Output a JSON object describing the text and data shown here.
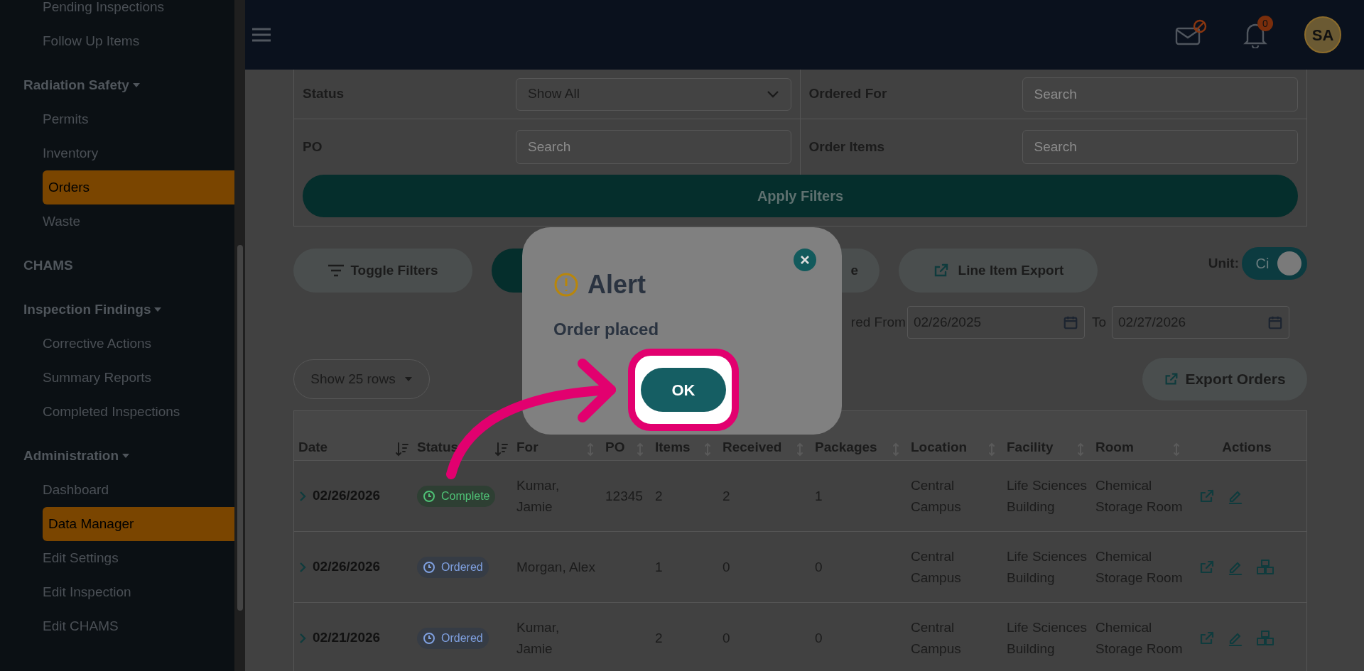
{
  "sidebar": {
    "groups": [
      {
        "items": [
          {
            "label": "Pending Inspections",
            "selected": false
          },
          {
            "label": "Follow Up Items",
            "selected": false
          }
        ]
      },
      {
        "title": "Radiation Safety",
        "expanded": true,
        "items": [
          {
            "label": "Permits",
            "selected": false
          },
          {
            "label": "Inventory",
            "selected": false
          },
          {
            "label": "Orders",
            "selected": true
          },
          {
            "label": "Waste",
            "selected": false
          }
        ]
      },
      {
        "title": "CHAMS"
      },
      {
        "title": "Inspection Findings",
        "expanded": true,
        "items": [
          {
            "label": "Corrective Actions",
            "selected": false
          },
          {
            "label": "Summary Reports",
            "selected": false
          },
          {
            "label": "Completed Inspections",
            "selected": false
          }
        ]
      },
      {
        "title": "Administration",
        "expanded": true,
        "items": [
          {
            "label": "Dashboard",
            "selected": false
          },
          {
            "label": "Data Manager",
            "selected": true
          },
          {
            "label": "Edit Settings",
            "selected": false
          },
          {
            "label": "Edit Inspection",
            "selected": false
          },
          {
            "label": "Edit CHAMS",
            "selected": false
          }
        ]
      }
    ]
  },
  "header": {
    "notifications_badge": "0",
    "avatar": "SA"
  },
  "filters": {
    "rows": [
      {
        "label": "Status",
        "kind": "select",
        "value": "Show All"
      },
      {
        "label": "Ordered For",
        "kind": "search",
        "placeholder": "Search"
      },
      {
        "label": "PO",
        "kind": "search",
        "placeholder": "Search"
      },
      {
        "label": "Order Items",
        "kind": "search",
        "placeholder": "Search"
      }
    ],
    "apply_button": "Apply Filters"
  },
  "toolbar": {
    "toggle_filters": "Toggle Filters",
    "covered_button": "e",
    "line_item_export": "Line Item Export",
    "unit_label": "Unit:",
    "unit_switch": {
      "label": "Ci",
      "on": true
    }
  },
  "date_range": {
    "from_label": "red From",
    "from": "02/26/2025",
    "to_label": "To",
    "to": "02/27/2026"
  },
  "rows_select": "Show 25 rows",
  "export_button": "Export Orders",
  "table": {
    "columns": [
      "Date",
      "Status",
      "For",
      "PO",
      "Items",
      "Received",
      "Packages",
      "Location",
      "Facility",
      "Room",
      "Actions"
    ],
    "rows": [
      {
        "date": "02/26/2026",
        "status": {
          "kind": "complete",
          "label": "Complete"
        },
        "ordered_for": "Kumar, Jamie",
        "po": "12345",
        "items": "2",
        "received": "2",
        "packages": "1",
        "location": "Central Campus",
        "facility": "Life Sciences Building",
        "room": "Chemical Storage Room",
        "package_action": false
      },
      {
        "date": "02/26/2026",
        "status": {
          "kind": "ordered",
          "label": "Ordered"
        },
        "ordered_for": "Morgan, Alex",
        "items": "1",
        "received": "0",
        "packages": "0",
        "location": "Central Campus",
        "facility": "Life Sciences Building",
        "room": "Chemical Storage Room",
        "package_action": true
      },
      {
        "date": "02/21/2026",
        "status": {
          "kind": "ordered",
          "label": "Ordered"
        },
        "ordered_for": "Kumar, Jamie",
        "items": "2",
        "received": "0",
        "packages": "0",
        "location": "Central Campus",
        "facility": "Life Sciences Building",
        "room": "Chemical Storage Room",
        "package_action": true
      }
    ]
  },
  "modal": {
    "title": "Alert",
    "message": "Order placed",
    "ok_button": "OK",
    "highlighted": true
  }
}
